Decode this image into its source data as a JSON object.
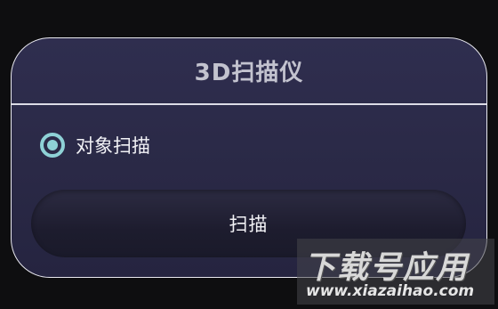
{
  "dialog": {
    "title": "3D扫描仪",
    "option": {
      "label": "对象扫描",
      "selected": true
    },
    "scan_button_label": "扫描"
  },
  "watermark": {
    "brand": "下载号应用",
    "url": "www.xiazaihao.com"
  },
  "colors": {
    "background": "#0e0e10",
    "dialog": "#2b2a48",
    "border": "#e9e9f0",
    "title": "#c3c3cf",
    "radio_accent": "#8ed1d6",
    "button": "#1f1e30",
    "text": "#f2f2f6"
  },
  "icons": {
    "option_radio": "radio-selected-icon"
  }
}
